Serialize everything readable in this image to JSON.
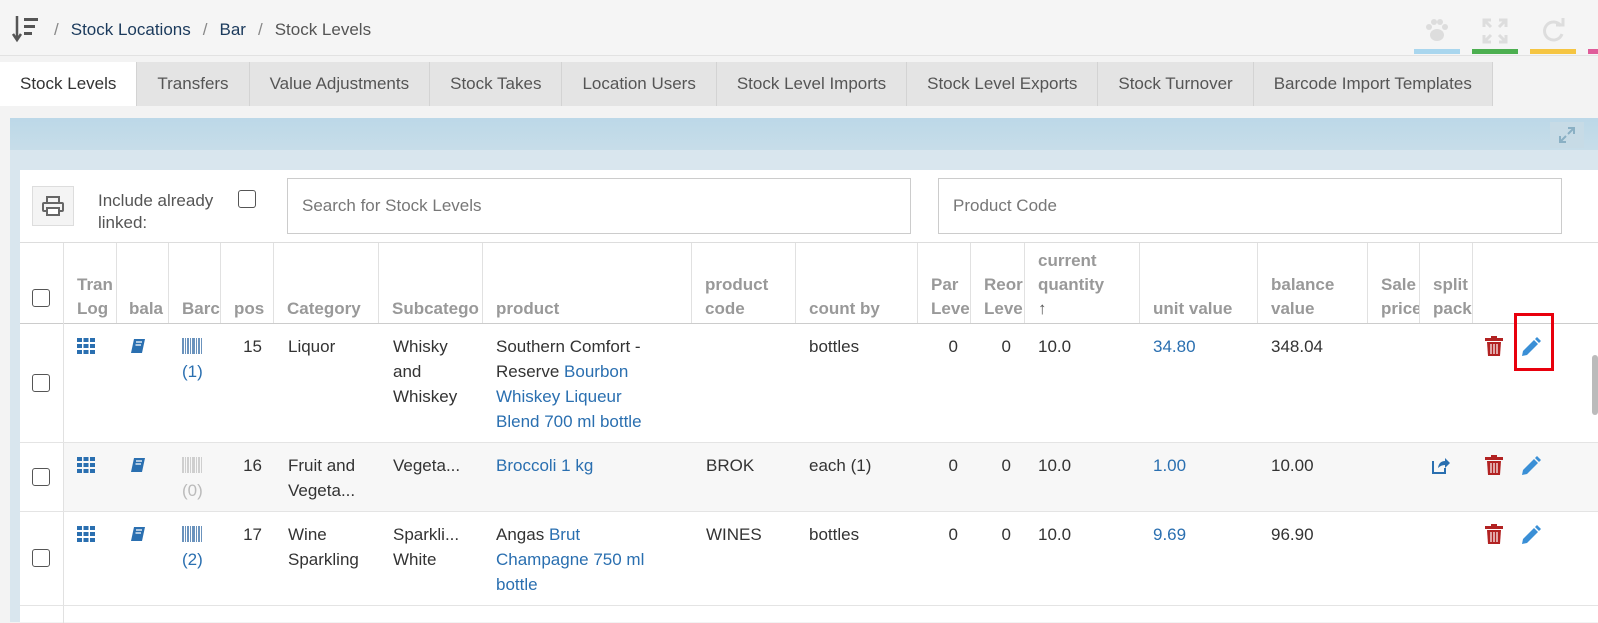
{
  "breadcrumb": {
    "items": [
      "Stock Locations",
      "Bar"
    ],
    "current": "Stock Levels",
    "separator": "/"
  },
  "header_tools": [
    {
      "icon": "paw-icon",
      "color": "#a9d6ee"
    },
    {
      "icon": "fullscreen-icon",
      "color": "#4caf50"
    },
    {
      "icon": "refresh-icon",
      "color": "#f5c542"
    },
    {
      "icon": "extra-icon",
      "color": "#e05c9a"
    }
  ],
  "tabs": [
    {
      "label": "Stock Levels",
      "active": true
    },
    {
      "label": "Transfers"
    },
    {
      "label": "Value Adjustments"
    },
    {
      "label": "Stock Takes"
    },
    {
      "label": "Location Users"
    },
    {
      "label": "Stock Level Imports"
    },
    {
      "label": "Stock Level Exports"
    },
    {
      "label": "Stock Turnover"
    },
    {
      "label": "Barcode Import Templates"
    }
  ],
  "toolbar": {
    "include_label_line1": "Include already",
    "include_label_line2": "linked:",
    "search_placeholder": "Search for Stock Levels",
    "product_code_placeholder": "Product Code"
  },
  "columns": {
    "tran_log": "Tran\nLog",
    "balance": "bala",
    "barcode": "Barc",
    "pos": "pos",
    "category": "Category",
    "subcategory": "Subcatego",
    "product": "product",
    "product_code": "product\ncode",
    "count_by": "count by",
    "par_level": "Par\nLeve",
    "reorder_level": "Reor\nLeve",
    "current_quantity": "current\nquantity",
    "sort_arrow": "↑",
    "unit_value": "unit value",
    "balance_value": "balance\nvalue",
    "sale_price": "Sale\nprice",
    "split_pack": "split\npack"
  },
  "rows": [
    {
      "barcode_count": "(1)",
      "pos": "15",
      "category": [
        "Liquor"
      ],
      "subcategory": [
        "Whisky",
        "and",
        "Whiskey"
      ],
      "product_plain": "Southern Comfort -",
      "product_line2_plain": "Reserve",
      "product_line2_link": "Bourbon",
      "product_link_lines": [
        "Whiskey Liqueur",
        "Blend 700 ml bottle"
      ],
      "product_code": "",
      "count_by": "bottles",
      "par": "0",
      "reorder": "0",
      "quantity": "10.0",
      "unit_value": "34.80",
      "balance_value": "348.04"
    },
    {
      "barcode_count": "(0)",
      "pos": "16",
      "category": [
        "Fruit and",
        "Vegeta..."
      ],
      "subcategory": [
        "Vegeta..."
      ],
      "product_link": "Broccoli 1 kg",
      "product_code": "BROK",
      "count_by": "each (1)",
      "par": "0",
      "reorder": "0",
      "quantity": "10.0",
      "unit_value": "1.00",
      "balance_value": "10.00"
    },
    {
      "barcode_count": "(2)",
      "pos": "17",
      "category": [
        "Wine",
        "Sparkling"
      ],
      "subcategory": [
        "Sparkli...",
        "White"
      ],
      "product_plain": "Angas",
      "product_line1_link": "Brut",
      "product_link_lines": [
        "Champagne 750 ml",
        "bottle"
      ],
      "product_code": "WINES",
      "count_by": "bottles",
      "par": "0",
      "reorder": "0",
      "quantity": "10.0",
      "unit_value": "9.69",
      "balance_value": "96.90"
    }
  ],
  "colors": {
    "link": "#2a6fb0",
    "delete": "#b22222",
    "edit": "#3a8fd6",
    "highlight": "#e8000d"
  }
}
